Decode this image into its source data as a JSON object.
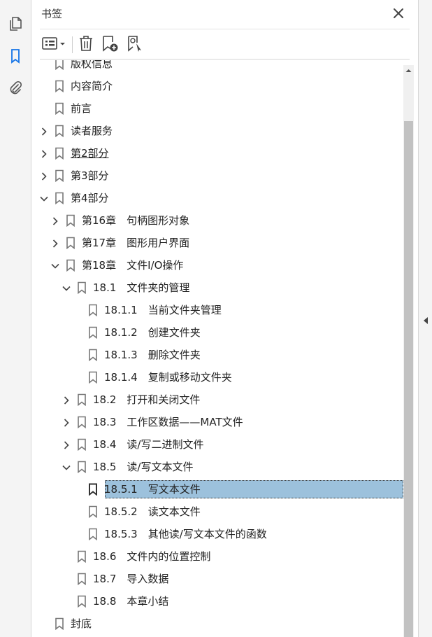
{
  "panel": {
    "title": "书签",
    "close_icon": "close-icon"
  },
  "toolbar": {
    "options_icon": "list-options-icon",
    "delete_icon": "trash-icon",
    "new_bookmark_icon": "new-bookmark-icon",
    "find_bookmark_icon": "bookmark-from-selection-icon"
  },
  "leftbar": {
    "icons": [
      "pages-icon",
      "bookmark-icon",
      "attachment-icon"
    ]
  },
  "colors": {
    "accent": "#1473e6",
    "selection": "#9cc1dc"
  },
  "bookmarks": [
    {
      "label": "版权信息",
      "level": 0,
      "chevron": "none"
    },
    {
      "label": "内容简介",
      "level": 0,
      "chevron": "none"
    },
    {
      "label": "前言",
      "level": 0,
      "chevron": "none"
    },
    {
      "label": "读者服务",
      "level": 0,
      "chevron": "right"
    },
    {
      "label": "第2部分",
      "level": 0,
      "chevron": "right",
      "underline": true
    },
    {
      "label": "第3部分",
      "level": 0,
      "chevron": "right"
    },
    {
      "label": "第4部分",
      "level": 0,
      "chevron": "down"
    },
    {
      "label": "第16章　句柄图形对象",
      "level": 1,
      "chevron": "right"
    },
    {
      "label": "第17章　图形用户界面",
      "level": 1,
      "chevron": "right"
    },
    {
      "label": "第18章　文件I/O操作",
      "level": 1,
      "chevron": "down"
    },
    {
      "label": "18.1　文件夹的管理",
      "level": 2,
      "chevron": "down"
    },
    {
      "label": "18.1.1　当前文件夹管理",
      "level": 3,
      "chevron": "none"
    },
    {
      "label": "18.1.2　创建文件夹",
      "level": 3,
      "chevron": "none"
    },
    {
      "label": "18.1.3　删除文件夹",
      "level": 3,
      "chevron": "none"
    },
    {
      "label": "18.1.4　复制或移动文件夹",
      "level": 3,
      "chevron": "none"
    },
    {
      "label": "18.2　打开和关闭文件",
      "level": 2,
      "chevron": "right"
    },
    {
      "label": "18.3　工作区数据——MAT文件",
      "level": 2,
      "chevron": "right"
    },
    {
      "label": "18.4　读/写二进制文件",
      "level": 2,
      "chevron": "right"
    },
    {
      "label": "18.5　读/写文本文件",
      "level": 2,
      "chevron": "down"
    },
    {
      "label": "18.5.1　写文本文件",
      "level": 3,
      "chevron": "none",
      "selected": true
    },
    {
      "label": "18.5.2　读文本文件",
      "level": 3,
      "chevron": "none"
    },
    {
      "label": "18.5.3　其他读/写文本文件的函数",
      "level": 3,
      "chevron": "none"
    },
    {
      "label": "18.6　文件内的位置控制",
      "level": 2,
      "chevron": "none"
    },
    {
      "label": "18.7　导入数据",
      "level": 2,
      "chevron": "none"
    },
    {
      "label": "18.8　本章小结",
      "level": 2,
      "chevron": "none"
    },
    {
      "label": "封底",
      "level": 0,
      "chevron": "none"
    }
  ]
}
